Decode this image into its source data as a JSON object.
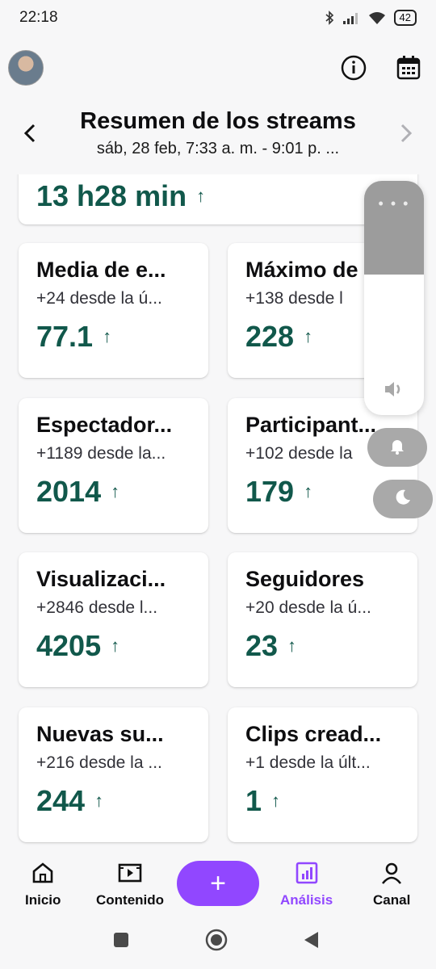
{
  "status": {
    "time": "22:18",
    "battery": "42"
  },
  "header": {
    "title": "Resumen de los streams",
    "subtitle": "sáb, 28 feb, 7:33 a. m. - 9:01 p. ..."
  },
  "top_card": {
    "value": "13 h28 min"
  },
  "cards": [
    {
      "title": "Media de e...",
      "sub": "+24 desde la ú...",
      "value": "77.1"
    },
    {
      "title": "Máximo de",
      "sub": "+138 desde l",
      "value": "228"
    },
    {
      "title": "Espectador...",
      "sub": "+1189 desde la...",
      "value": "2014"
    },
    {
      "title": "Participant...",
      "sub": "+102 desde la",
      "value": "179"
    },
    {
      "title": "Visualizaci...",
      "sub": "+2846 desde l...",
      "value": "4205"
    },
    {
      "title": "Seguidores",
      "sub": "+20 desde la ú...",
      "value": "23"
    },
    {
      "title": "Nuevas su...",
      "sub": "+216 desde la ...",
      "value": "244"
    },
    {
      "title": "Clips cread...",
      "sub": "+1 desde la últ...",
      "value": "1"
    }
  ],
  "arrow": "↑",
  "volume": {
    "dots": "• • •",
    "level_fraction": 0.4
  },
  "bottom_nav": {
    "inicio": "Inicio",
    "contenido": "Contenido",
    "add": "+",
    "analisis": "Análisis",
    "canal": "Canal"
  },
  "colors": {
    "accent": "#9147ff",
    "value": "#11584b"
  }
}
